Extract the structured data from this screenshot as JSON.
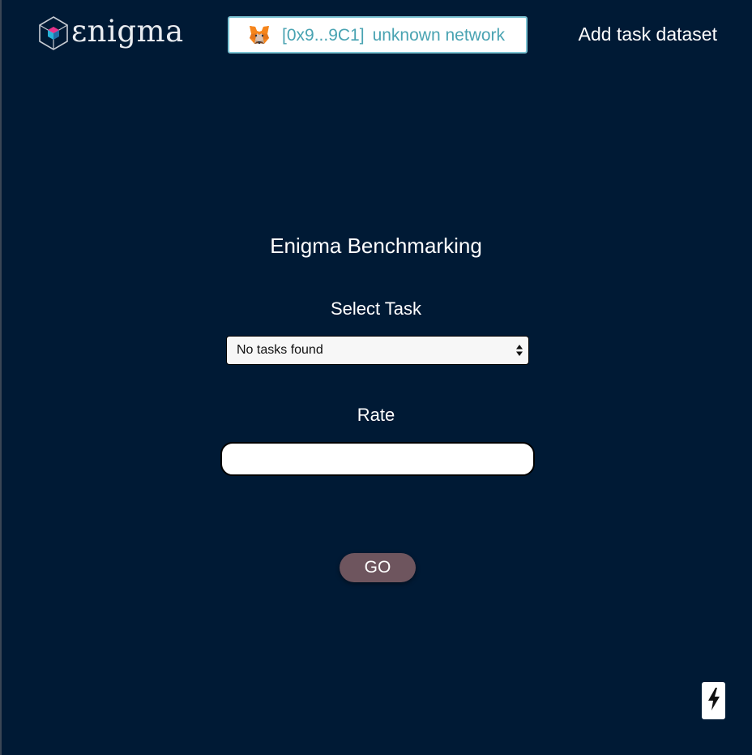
{
  "header": {
    "logo_text": "ɛnigma",
    "wallet": {
      "address": "[0x9...9C1]",
      "network": "unknown network"
    },
    "add_task_label": "Add task dataset"
  },
  "main": {
    "title": "Enigma Benchmarking",
    "select_task_label": "Select Task",
    "task_select_value": "No tasks found",
    "rate_label": "Rate",
    "rate_value": "",
    "go_label": "GO"
  },
  "icons": {
    "logo": "enigma-cube-icon",
    "wallet": "metamask-fox-icon",
    "select": "select-arrows-icon",
    "floating": "lightning-bolt-icon"
  },
  "colors": {
    "background": "#001a35",
    "wallet_text": "#49a3b2",
    "wallet_border": "#7cc4d4",
    "go_button": "#6e555e",
    "logo_pink": "#e8338a",
    "logo_blue": "#27b3d8"
  }
}
